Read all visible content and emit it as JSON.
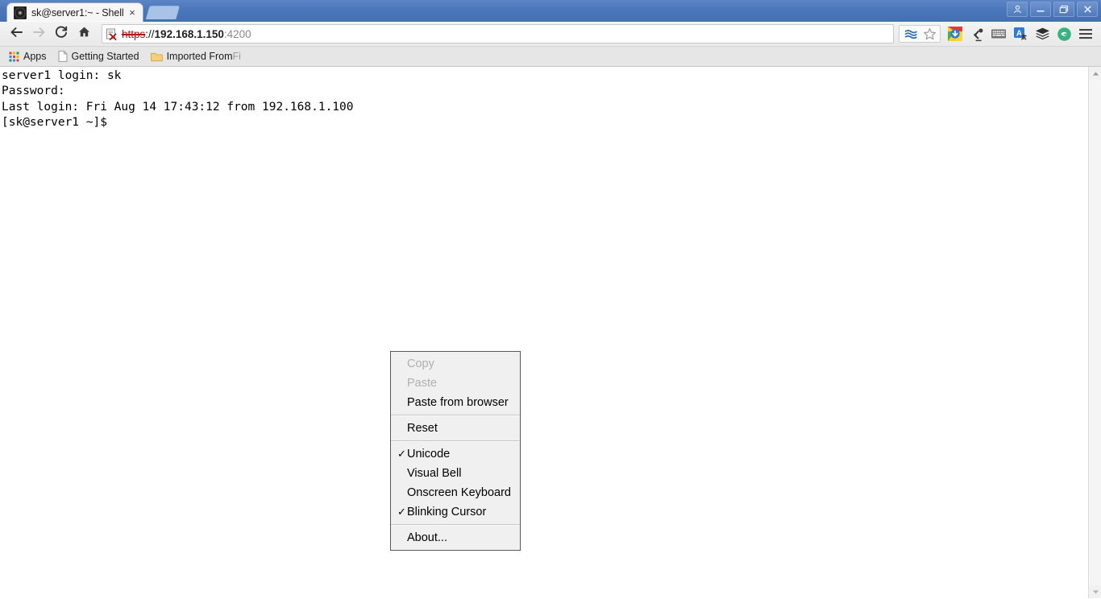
{
  "window": {
    "controls": [
      {
        "name": "user-profile-button",
        "glyph": "user"
      },
      {
        "name": "minimize-button",
        "glyph": "minimize"
      },
      {
        "name": "maximize-button",
        "glyph": "maximize"
      },
      {
        "name": "close-button",
        "glyph": "close"
      }
    ]
  },
  "tab": {
    "title": "sk@server1:~ - Shell",
    "close_label": "×",
    "favicon": "shell-in-a-box-icon"
  },
  "toolbar": {
    "back": "back-arrow-icon",
    "forward": "forward-arrow-icon",
    "reload": "reload-icon",
    "home": "home-icon",
    "url": {
      "security_icon": "insecure-https-icon",
      "scheme": "https",
      "separator": "://",
      "host": "192.168.1.150",
      "port": ":4200",
      "full": "https://192.168.1.150:4200"
    },
    "right_icons": [
      {
        "name": "reading-list-icon",
        "label": "Reading list"
      },
      {
        "name": "bookmark-star-icon",
        "label": "Bookmark this page"
      },
      {
        "name": "download-manager-icon",
        "label": "Downloads"
      },
      {
        "name": "desk-lamp-icon",
        "label": "Extension"
      },
      {
        "name": "keyboard-icon",
        "label": "Onscreen keyboard extension"
      },
      {
        "name": "translate-icon",
        "label": "Translate"
      },
      {
        "name": "layers-icon",
        "label": "Extension"
      },
      {
        "name": "evernote-icon",
        "label": "Extension"
      },
      {
        "name": "chrome-menu-icon",
        "label": "Customize and control"
      }
    ]
  },
  "bookmarks": {
    "items": [
      {
        "name": "bookmark-apps",
        "label": "Apps",
        "icon": "apps-grid-icon"
      },
      {
        "name": "bookmark-getting-started",
        "label": "Getting Started",
        "icon": "page-icon"
      },
      {
        "name": "bookmark-imported",
        "label": "Imported From ",
        "label_truncated": "Fi",
        "icon": "folder-icon"
      }
    ]
  },
  "terminal": {
    "lines": [
      "server1 login: sk",
      "Password:",
      "Last login: Fri Aug 14 17:43:12 from 192.168.1.100",
      "[sk@server1 ~]$"
    ],
    "text": "server1 login: sk\nPassword:\nLast login: Fri Aug 14 17:43:12 from 192.168.1.100\n[sk@server1 ~]$",
    "background": "#ffffff",
    "foreground": "#000000"
  },
  "context_menu": {
    "groups": [
      {
        "items": [
          {
            "name": "menu-item-copy",
            "label": "Copy",
            "disabled": true,
            "checked": false
          },
          {
            "name": "menu-item-paste",
            "label": "Paste",
            "disabled": true,
            "checked": false
          },
          {
            "name": "menu-item-paste-from-browser",
            "label": "Paste from browser",
            "disabled": false,
            "checked": false
          }
        ]
      },
      {
        "items": [
          {
            "name": "menu-item-reset",
            "label": "Reset",
            "disabled": false,
            "checked": false
          }
        ]
      },
      {
        "items": [
          {
            "name": "menu-item-unicode",
            "label": "Unicode",
            "disabled": false,
            "checked": true
          },
          {
            "name": "menu-item-visual-bell",
            "label": "Visual Bell",
            "disabled": false,
            "checked": false
          },
          {
            "name": "menu-item-onscreen-keyboard",
            "label": "Onscreen Keyboard",
            "disabled": false,
            "checked": false
          },
          {
            "name": "menu-item-blinking-cursor",
            "label": "Blinking Cursor",
            "disabled": false,
            "checked": true
          }
        ]
      },
      {
        "items": [
          {
            "name": "menu-item-about",
            "label": "About...",
            "disabled": false,
            "checked": false
          }
        ]
      }
    ],
    "check_glyph": "✓"
  },
  "colors": {
    "titlebar": "#4a76ba",
    "toolbar": "#eeeeee",
    "bookmarks_bar": "#e6e6e6",
    "menu_background": "#f0f0f0",
    "menu_border": "#5a5a5a",
    "insecure_red": "#b31414",
    "disabled_text": "#b0b0b0"
  }
}
